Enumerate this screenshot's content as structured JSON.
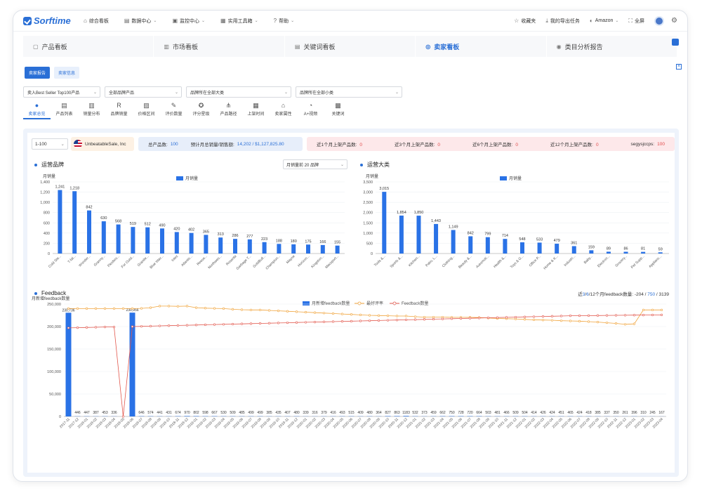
{
  "nav": {
    "logo": "Sorftime",
    "items": [
      "综合看板",
      "数据中心",
      "监控中心",
      "实用工具箱",
      "帮助"
    ],
    "right": {
      "favorites": "收藏夹",
      "export": "我的导出任务",
      "marketplace": "Amazon",
      "fullscreen": "全屏"
    }
  },
  "tabs": [
    "产品看板",
    "市场看板",
    "关键词看板",
    "卖家看板",
    "类目分析报告"
  ],
  "subtabs": [
    "卖家报告",
    "卖家信息"
  ],
  "filters": {
    "top100": "卖入Best Seller Top100产品",
    "brand": "全部品牌产品",
    "bigcat": "品牌所在全部大类",
    "smallcat": "品牌所在全部小类"
  },
  "icon_tabs": [
    "卖家总览",
    "产品列表",
    "销量分布",
    "品牌销量",
    "价格区间",
    "评价数量",
    "评分星级",
    "产品路径",
    "上架时间",
    "卖家属性",
    "A+视频",
    "关键词"
  ],
  "stats": {
    "rank": "1-100",
    "seller": "UnbeatableSale, Inc",
    "total_label": "总产品数:",
    "total_value": "100",
    "sales_label": "预计月总销量/销售额:",
    "sales_value": "14,202 / $1,127,825.80",
    "new1_label": "近1个月上架产品数:",
    "new1_value": "0",
    "new3_label": "近3个月上架产品数:",
    "new3_value": "0",
    "new6_label": "近6个月上架产品数:",
    "new6_value": "0",
    "new12_label": "近12个月上架产品数:",
    "new12_value": "0",
    "other_label": "segysjccps:",
    "other_value": "100"
  },
  "brand_chart": {
    "section_title": "运营品牌",
    "select": "月销量前 20 品牌",
    "ylabel": "月销量",
    "legend": "月销量"
  },
  "category_chart": {
    "section_title": "运营大类",
    "ylabel": "月销量",
    "legend": "月销量"
  },
  "feedback_chart": {
    "section_title": "Feedback",
    "ylabel": "月新增feedback数量",
    "legend": [
      "月新增feedback数量",
      "最好评率",
      "Feedback数量"
    ],
    "stat_prefix": "近",
    "stat_3": "3",
    "stat_6": "6",
    "stat_12": "12个月feedback数量:",
    "stat_v1": "-204",
    "stat_v2": "750",
    "stat_v3": "3139"
  },
  "colors": {
    "accent": "#2a6fd6",
    "bar": "#2a72e6",
    "orange": "#f0a33a",
    "red": "#e2574c"
  },
  "chart_data": [
    {
      "type": "bar",
      "ylabel": "月销量",
      "ylim": [
        0,
        1400
      ],
      "yticks": [
        0,
        200,
        400,
        600,
        800,
        1000,
        1200,
        1400
      ],
      "categories": [
        "Cold Ste...",
        "T-fal...",
        "Wonder...",
        "Granny...",
        "Flexfers...",
        "For Outd...",
        "Granite...",
        "Blue Wav...",
        "Intex",
        "Atlantic...",
        "Reese...",
        "Northwes...",
        "Rosanta",
        "Garbage T...",
        "GoldBull...",
        "Champion...",
        "Mayne",
        "Horizon...",
        "Kingston...",
        "Macsport..."
      ],
      "series": [
        {
          "name": "月销量",
          "values": [
            1241,
            1218,
            842,
            630,
            568,
            519,
            512,
            490,
            420,
            402,
            365,
            313,
            286,
            277,
            223,
            188,
            180,
            175,
            166,
            155
          ]
        }
      ]
    },
    {
      "type": "bar",
      "ylabel": "月销量",
      "ylim": [
        0,
        3500
      ],
      "yticks": [
        0,
        500,
        1000,
        1500,
        2000,
        2500,
        3000,
        3500
      ],
      "categories": [
        "Tools &...",
        "Sports &...",
        "Kitchen...",
        "Patio, L...",
        "Clothing...",
        "Beauty &...",
        "Automoti...",
        "Health &...",
        "Toys & G...",
        "Office P...",
        "Home & K...",
        "Industri...",
        "Baby...",
        "Electron...",
        "Grocery...",
        "Pet Supp...",
        "Applianc..."
      ],
      "series": [
        {
          "name": "月销量",
          "values": [
            3015,
            1854,
            1850,
            1443,
            1149,
            842,
            799,
            714,
            548,
            533,
            479,
            361,
            159,
            89,
            86,
            81,
            59
          ]
        }
      ]
    },
    {
      "type": "bar+line",
      "ylabel": "月新增feedback数量",
      "ylim": [
        0,
        250000
      ],
      "yticks": [
        0,
        50000,
        100000,
        150000,
        200000,
        250000
      ],
      "categories": [
        "2017-11",
        "2017-12",
        "2018-01",
        "2018-02",
        "2018-03",
        "2018-04",
        "2018-05",
        "2018-06",
        "2018-07",
        "2018-08",
        "2018-09",
        "2018-10",
        "2018-11",
        "2018-12",
        "2019-01",
        "2019-02",
        "2019-03",
        "2019-04",
        "2019-05",
        "2019-06",
        "2019-07",
        "2019-08",
        "2019-09",
        "2019-10",
        "2019-11",
        "2019-12",
        "2020-01",
        "2020-02",
        "2020-03",
        "2020-04",
        "2020-05",
        "2020-06",
        "2020-07",
        "2020-08",
        "2020-09",
        "2020-10",
        "2020-11",
        "2020-12",
        "2021-01",
        "2021-02",
        "2021-03",
        "2021-04",
        "2021-05",
        "2021-06",
        "2021-07",
        "2021-08",
        "2021-09",
        "2021-10",
        "2021-11",
        "2021-12",
        "2022-01",
        "2022-02",
        "2022-03",
        "2022-04",
        "2022-05",
        "2022-06",
        "2022-07",
        "2022-08",
        "2022-09",
        "2022-10",
        "2022-11",
        "2022-12",
        "2023-01",
        "2023-02",
        "2023-03",
        "2023-04"
      ],
      "series": [
        {
          "name": "月新增feedback数量",
          "values": [
            230736,
            446,
            447,
            387,
            453,
            336,
            0,
            230956,
            646,
            574,
            441,
            431,
            674,
            970,
            802,
            598,
            667,
            530,
            509,
            485,
            499,
            499,
            385,
            435,
            407,
            480,
            339,
            316,
            379,
            416,
            493,
            515,
            409,
            480,
            364,
            827,
            863,
            1183,
            532,
            373,
            459,
            662,
            750,
            728,
            720,
            664,
            503,
            481,
            466,
            509,
            504,
            414,
            426,
            424,
            451,
            465,
            424,
            418,
            385,
            337,
            350,
            261,
            396,
            310,
            245,
            167
          ]
        },
        {
          "name": "最好评率",
          "values": [
            240000,
            240000,
            240000,
            240000,
            240000,
            240000,
            240000,
            240000,
            240500,
            242000,
            245500,
            245500,
            245000,
            245500,
            242000,
            241000,
            240500,
            240000,
            238500,
            237500,
            237000,
            237000,
            236000,
            235000,
            234000,
            233000,
            232000,
            231000,
            230000,
            229000,
            228000,
            227000,
            226000,
            225000,
            224500,
            224000,
            223500,
            223500,
            222000,
            221000,
            221000,
            221000,
            220500,
            220500,
            220500,
            220000,
            219000,
            218000,
            217500,
            217000,
            216000,
            215000,
            214500,
            214000,
            213000,
            212500,
            212000,
            211000,
            210000,
            208500,
            207000,
            205000,
            206000,
            237000,
            237000,
            237000
          ]
        },
        {
          "name": "Feedback数量",
          "values": [
            197000,
            197500,
            198000,
            198500,
            199000,
            199000,
            0,
            200000,
            200500,
            201000,
            201500,
            202000,
            202500,
            203000,
            203500,
            204000,
            204500,
            205000,
            205500,
            206000,
            206500,
            207000,
            207500,
            208000,
            208500,
            209000,
            209500,
            210000,
            210500,
            211000,
            211500,
            212000,
            212500,
            213000,
            213500,
            214000,
            214500,
            215000,
            215500,
            216000,
            216500,
            217000,
            217500,
            218000,
            218500,
            219000,
            219500,
            220000,
            220500,
            221000,
            221500,
            222000,
            222500,
            223000,
            223500,
            224000,
            224200,
            224400,
            224600,
            224800,
            225000,
            225200,
            225400,
            225600,
            225800,
            226000
          ]
        }
      ]
    }
  ]
}
